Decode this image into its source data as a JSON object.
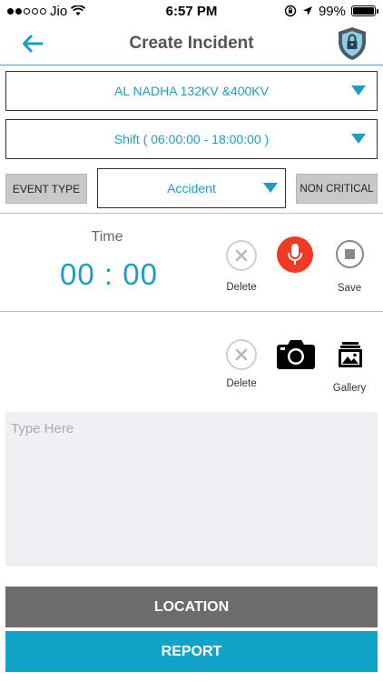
{
  "status_bar": {
    "carrier": "Jio",
    "time": "6:57 PM",
    "battery": "99%",
    "battery_level": 0.99
  },
  "header": {
    "title": "Create Incident",
    "back_icon": "arrow-left-icon",
    "logo_icon": "shield-lock-icon"
  },
  "form": {
    "station": "AL NADHA 132KV &400KV",
    "shift": "Shift ( 06:00:00 - 18:00:00 )",
    "event_type_label": "EVENT TYPE",
    "event_type_value": "Accident",
    "criticality": "NON CRITICAL"
  },
  "audio": {
    "time_label": "Time",
    "time_value": "00 : 00",
    "delete_label": "Delete",
    "save_label": "Save"
  },
  "media": {
    "delete_label": "Delete",
    "gallery_label": "Gallery"
  },
  "description": {
    "placeholder": "Type Here"
  },
  "actions": {
    "location": "LOCATION",
    "report": "REPORT"
  },
  "colors": {
    "accent": "#1a9fc4",
    "record": "#f03a24",
    "location_button": "#6c6c6c",
    "report_button": "#12a3c9"
  }
}
